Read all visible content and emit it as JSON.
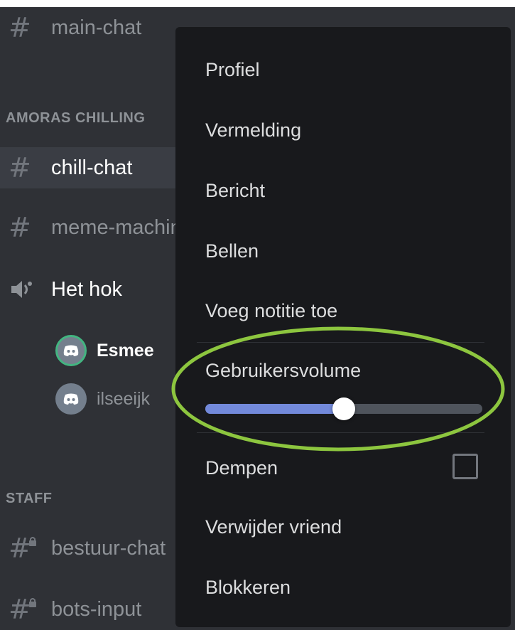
{
  "channels": {
    "main_chat": "main-chat",
    "category_amoras": "AMORAS CHILLING",
    "chill_chat": "chill-chat",
    "meme_machine": "meme-machine",
    "voice_het_hok": "Het hok",
    "category_staff": "STAFF",
    "bestuur_chat": "bestuur-chat",
    "bots_input": "bots-input"
  },
  "voice_users": [
    {
      "name": "Esmee",
      "speaking": true
    },
    {
      "name": "ilseeijk",
      "speaking": false
    }
  ],
  "context_menu": {
    "items": {
      "profiel": "Profiel",
      "vermelding": "Vermelding",
      "bericht": "Bericht",
      "bellen": "Bellen",
      "notitie": "Voeg notitie toe",
      "volume_label": "Gebruikersvolume",
      "dempen": "Dempen",
      "verwijder": "Verwijder vriend",
      "blokkeren": "Blokkeren"
    },
    "user_volume_fraction": 0.5,
    "dempen_checked": false
  },
  "colors": {
    "slider_fill": "#7289da",
    "highlight_ring": "#8dc63f",
    "speaking_ring": "#43b581"
  },
  "icons": {
    "text_channel": "hash-icon",
    "voice_channel": "speaker-icon",
    "locked_channel": "hash-lock-icon",
    "avatar": "discord-logo-icon"
  }
}
